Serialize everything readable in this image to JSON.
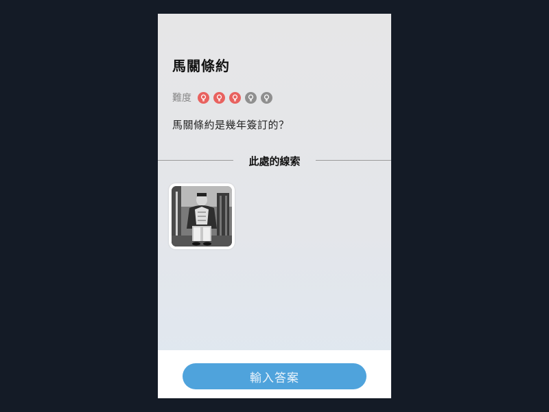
{
  "level": {
    "title": "馬關條約",
    "difficulty_label": "難度",
    "difficulty": {
      "filled": 3,
      "total": 5
    },
    "question": "馬關條約是幾年簽訂的？"
  },
  "clues": {
    "section_title": "此處的線索",
    "items": [
      {
        "icon": "clue-photo-icon"
      }
    ]
  },
  "footer": {
    "answer_button_label": "輸入答案"
  },
  "colors": {
    "accent": "#4fa3dc",
    "difficulty_filled": "#e8625f",
    "difficulty_empty": "#8f8f8f",
    "backdrop": "#141b26"
  }
}
